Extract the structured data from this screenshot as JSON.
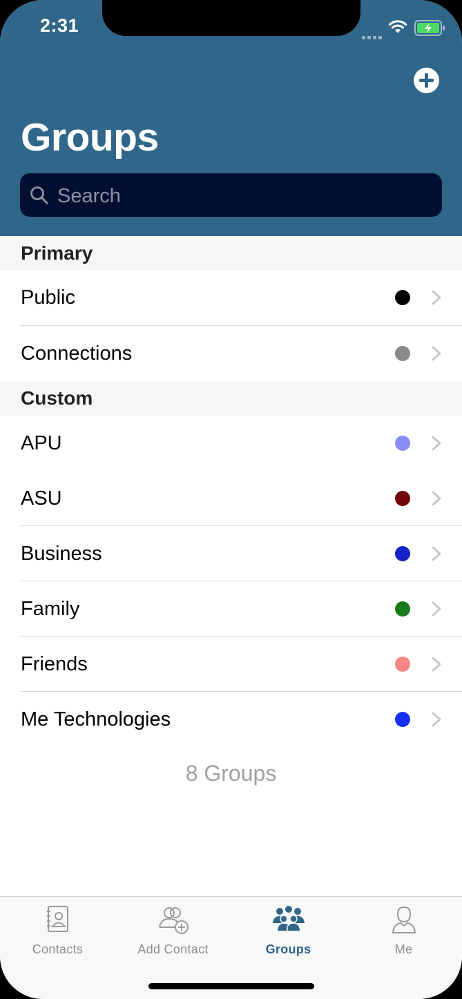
{
  "status_bar": {
    "time": "2:31"
  },
  "header": {
    "title": "Groups"
  },
  "search": {
    "placeholder": "Search"
  },
  "sections": [
    {
      "title": "Primary",
      "items": [
        {
          "label": "Public",
          "color": "#000000"
        },
        {
          "label": "Connections",
          "color": "#8a8a8a"
        }
      ]
    },
    {
      "title": "Custom",
      "items": [
        {
          "label": "APU",
          "color": "#8a8cf5"
        },
        {
          "label": "ASU",
          "color": "#6e0508"
        },
        {
          "label": "Business",
          "color": "#1220c8"
        },
        {
          "label": "Family",
          "color": "#1a7a1a"
        },
        {
          "label": "Friends",
          "color": "#f78686"
        },
        {
          "label": "Me Technologies",
          "color": "#1630f5"
        }
      ]
    }
  ],
  "footer": {
    "count_label": "8 Groups"
  },
  "tabbar": {
    "tabs": [
      {
        "label": "Contacts",
        "icon": "contacts-icon",
        "active": false
      },
      {
        "label": "Add Contact",
        "icon": "add-contact-icon",
        "active": false
      },
      {
        "label": "Groups",
        "icon": "groups-icon",
        "active": true
      },
      {
        "label": "Me",
        "icon": "person-icon",
        "active": false
      }
    ]
  },
  "colors": {
    "header": "#306689",
    "search_bg": "#020f30",
    "accent": "#306689"
  }
}
